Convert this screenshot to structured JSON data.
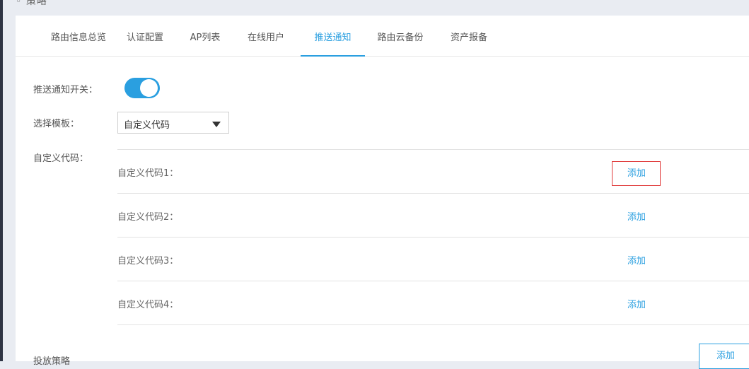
{
  "header": {
    "title_fragment": "◦ 策略"
  },
  "tabs": [
    {
      "label": "路由信息总览"
    },
    {
      "label": "认证配置"
    },
    {
      "label": "AP列表"
    },
    {
      "label": "在线用户"
    },
    {
      "label": "推送通知",
      "active": true
    },
    {
      "label": "路由云备份"
    },
    {
      "label": "资产报备"
    }
  ],
  "form": {
    "push_switch_label": "推送通知开关：",
    "push_switch_on": true,
    "template_label": "选择模板：",
    "template_value": "自定义代码",
    "custom_code_label": "自定义代码："
  },
  "custom_codes": [
    {
      "label": "自定义代码1：",
      "action": "添加"
    },
    {
      "label": "自定义代码2：",
      "action": "添加"
    },
    {
      "label": "自定义代码3：",
      "action": "添加"
    },
    {
      "label": "自定义代码4：",
      "action": "添加"
    }
  ],
  "bottom": {
    "section_label": "投放策略",
    "add_button_label": "添加"
  },
  "colors": {
    "accent": "#2a9fe0",
    "highlight": "#e03b3b"
  }
}
